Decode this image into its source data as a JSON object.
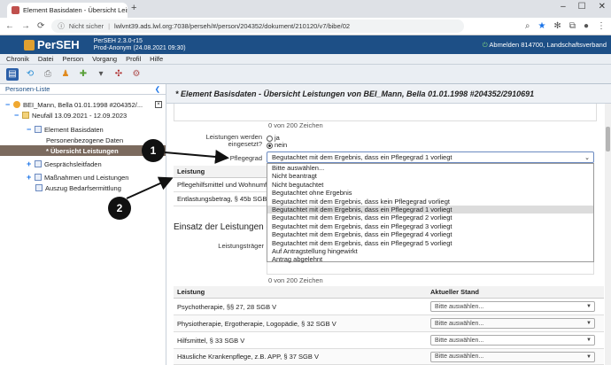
{
  "browser": {
    "tab_title": "Element Basisdaten - Übersicht Leistungen",
    "security": "Nicht sicher",
    "url": "lwlvnt39.ads.lwl.org:7038/perseh/#/person/204352/dokument/210120/v7/bibe/02"
  },
  "app": {
    "name": "PerSEH",
    "version": "PerSEH 2.3.0-r15",
    "env": "Prod-Anonym (24.08.2021 09:30)",
    "logout": "Abmelden 814700, Landschaftsverband"
  },
  "menu": [
    "Chronik",
    "Datei",
    "Person",
    "Vorgang",
    "Profil",
    "Hilfe"
  ],
  "sidebar": {
    "title": "Personen-Liste",
    "person": "BEI_Mann, Bella 01.01.1998 #204352/...",
    "period": "Neufall 13.09.2021 - 12.09.2023",
    "element": "Element Basisdaten",
    "personal": "Personenbezogene Daten",
    "selected": "* Übersicht Leistungen",
    "talk": "Gesprächsleitfaden",
    "measures": "Maßnahmen und Leistungen",
    "extract": "Auszug Bedarfsermittlung"
  },
  "main": {
    "title": "* Element Basisdaten - Übersicht Leistungen von  BEI_Mann, Bella 01.01.1998 #204352/2910691",
    "char_count_1": "0 von 200 Zeichen",
    "services_label": "Leistungen werden eingesetzt?",
    "radio_yes": "ja",
    "radio_no": "nein",
    "care_label": "Pflegegrad",
    "care_value": "Begutachtet mit dem Ergebnis, dass ein Pflegegrad 1 vorliegt",
    "options": [
      "Bitte auswählen...",
      "Nicht beantragt",
      "Nicht begutachtet",
      "Begutachtet ohne Ergebnis",
      "Begutachtet mit dem Ergebnis, dass kein Pflegegrad vorliegt",
      "Begutachtet mit dem Ergebnis, dass ein Pflegegrad 1 vorliegt",
      "Begutachtet mit dem Ergebnis, dass ein Pflegegrad 2 vorliegt",
      "Begutachtet mit dem Ergebnis, dass ein Pflegegrad 3 vorliegt",
      "Begutachtet mit dem Ergebnis, dass ein Pflegegrad 4 vorliegt",
      "Begutachtet mit dem Ergebnis, dass ein Pflegegrad 5 vorliegt",
      "Auf Antragstellung hingewirkt",
      "Antrag abgelehnt"
    ],
    "left_table": {
      "header": "Leistung",
      "rows": [
        "Pflegehilfsmittel und Wohnumf",
        "Entlastungsbetrag, § 45b SGB"
      ]
    },
    "section2": "Einsatz der Leistungen d",
    "carrier_label": "Leistungsträger",
    "char_count_2": "0 von 200 Zeichen",
    "table": {
      "col1": "Leistung",
      "col2": "Aktueller Stand",
      "placeholder": "Bitte auswählen...",
      "rows": [
        "Psychotherapie, §§ 27, 28 SGB V",
        "Physiotherapie, Ergotherapie, Logopädie, § 32 SGB V",
        "Hilfsmittel, § 33 SGB V",
        "Häusliche Krankenpflege, z.B. APP, § 37 SGB V"
      ]
    }
  },
  "callouts": [
    "1",
    "2"
  ],
  "colors": {
    "app_header": "#1d4f86",
    "selected_row": "#7b6a5e"
  }
}
